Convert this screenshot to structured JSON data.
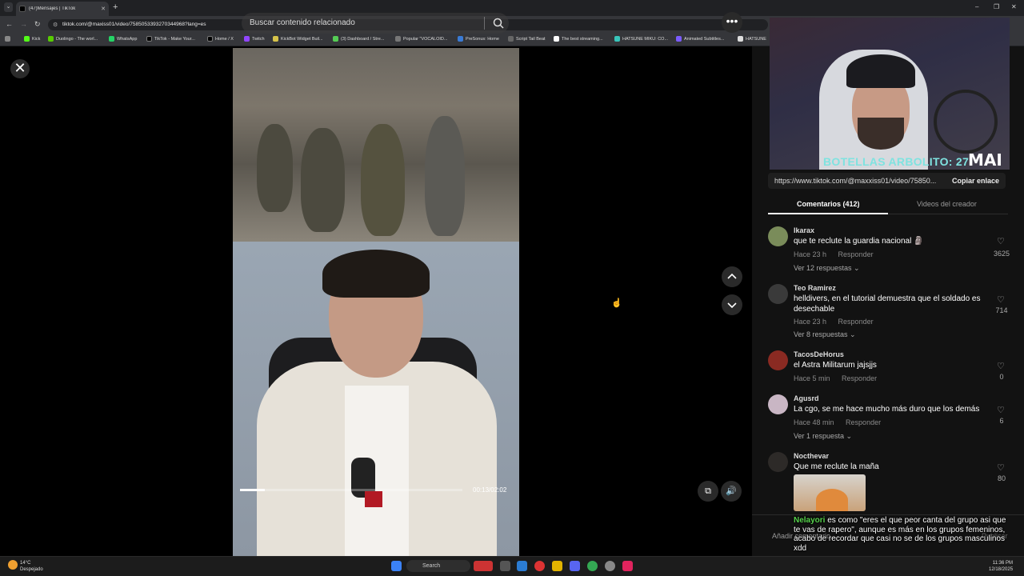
{
  "browser": {
    "tab_title": "(47)Mensajes | TikTok",
    "url": "tiktok.com/@maxiss01/video/7585053393270344968?lang=es",
    "bookmarks": [
      "Kick",
      "Duolingo - The worl...",
      "WhatsApp",
      "TikTok - Make Your...",
      "Home / X",
      "Twitch",
      "KickBot Widget Buil...",
      "(3) Dashboard / Stre...",
      "Popular \"VOCALOID...",
      "PreSonus: Home",
      "Script Tail Beat",
      "The best streaming...",
      "HATSUNE MIKU: CO...",
      "Animated Subtitles...",
      "HATSUNE"
    ]
  },
  "player": {
    "search_placeholder": "Buscar contenido relacionado",
    "time": "00:13/02:02",
    "progress_fraction": 0.11
  },
  "webcam": {
    "overlay_text": "BOTELLAS ARBOLITO: 27",
    "logo": "MAI"
  },
  "panel": {
    "link": "https://www.tiktok.com/@maxxiss01/video/75850...",
    "copy_label": "Copiar enlace",
    "tab_comments": "Comentarios (412)",
    "tab_videos": "Videos del creador",
    "reply_label": "Responder",
    "add_comment": "Añadir comentario...",
    "post_label": "Publicar"
  },
  "comments": [
    {
      "user": "Ikarax",
      "text": "que te reclute la guardia nacional 🗿",
      "time": "Hace 23 h",
      "likes": "3625",
      "replies": "Ver 12 respuestas",
      "avatar_color": "#7a8c5a"
    },
    {
      "user": "Teo Ramirez",
      "text": "helldivers, en el tutorial demuestra que el soldado es desechable",
      "time": "Hace 23 h",
      "likes": "714",
      "replies": "Ver 8 respuestas",
      "avatar_color": "#3a3a3a"
    },
    {
      "user": "TacosDeHorus",
      "text": "el Astra Militarum jajsjjs",
      "time": "Hace 5 min",
      "likes": "0",
      "replies": "",
      "avatar_color": "#8a2a22"
    },
    {
      "user": "Agusrd",
      "text": "La cgo, se me hace mucho más duro que los demás",
      "time": "Hace 48 min",
      "likes": "6",
      "replies": "Ver 1 respuesta",
      "avatar_color": "#c9b6c4"
    },
    {
      "user": "Nocthevar",
      "text": "Que me reclute la maña",
      "time": "",
      "likes": "80",
      "replies": "",
      "avatar_color": "#2d2a28"
    }
  ],
  "chat": {
    "user": "Nelayori",
    "message": "es como \"eres el que peor canta del grupo asi que te vas de rapero\", aunque es más en los grupos femeninos, acabo de recordar que casi no se de los grupos masculinos xdd"
  },
  "taskbar": {
    "temp": "14°C",
    "weather": "Despejado",
    "search": "Search",
    "time": "11:36 PM",
    "date": "12/18/2025"
  }
}
